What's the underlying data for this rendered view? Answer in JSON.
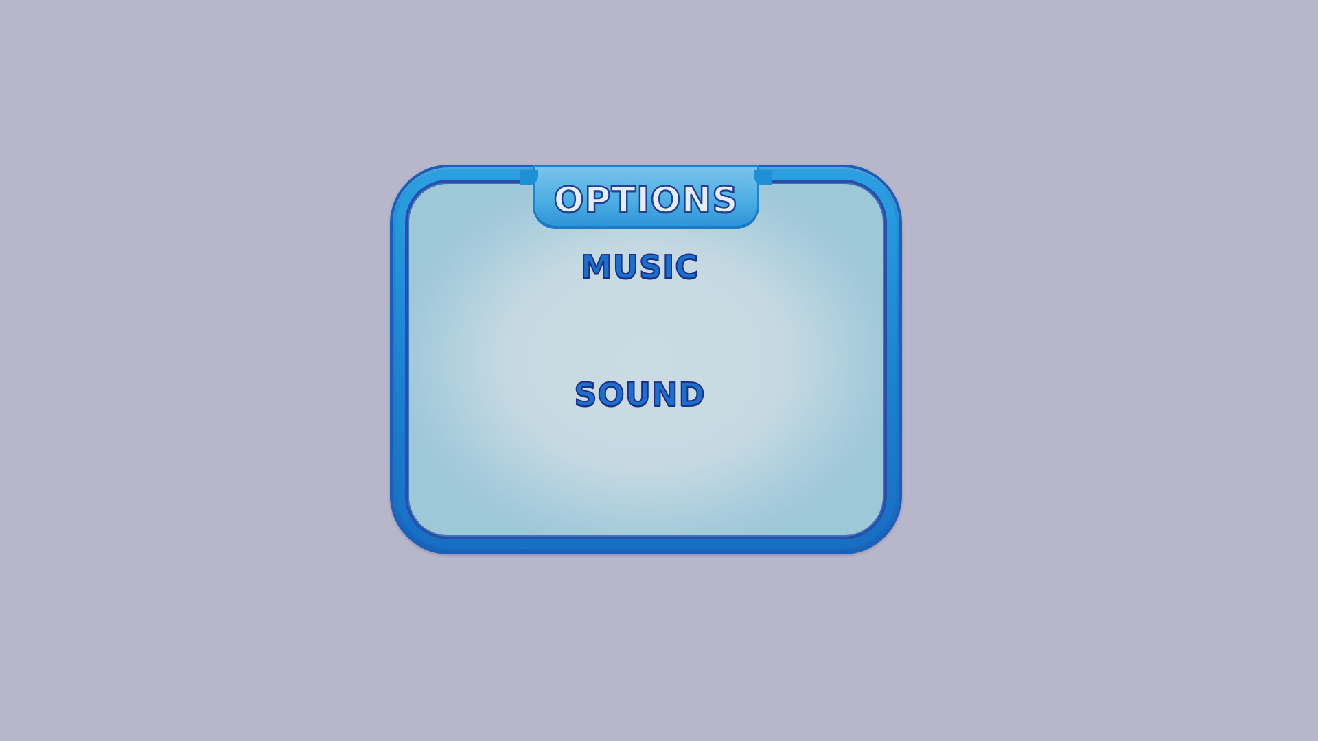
{
  "options_dialog": {
    "title": "OPTIONS",
    "items": [
      {
        "label": "MUSIC"
      },
      {
        "label": "SOUND"
      }
    ]
  },
  "colors": {
    "background": "#b7b6cb",
    "frame": "#1f8fd6",
    "inner_panel": "#c6d9e2",
    "text": "#1e6fcc",
    "text_outline": "#1d2f86"
  }
}
